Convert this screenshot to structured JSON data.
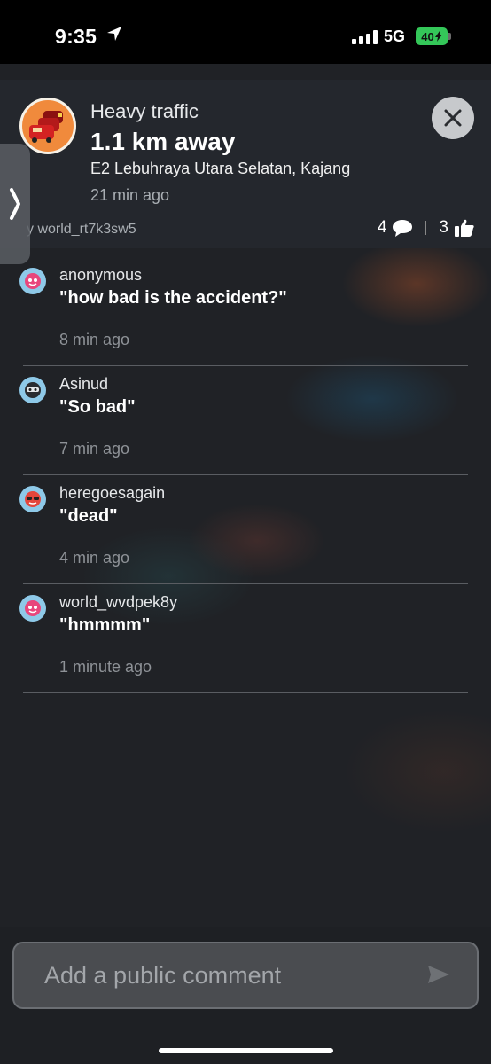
{
  "status_bar": {
    "time": "9:35",
    "network": "5G",
    "battery": "40"
  },
  "alert": {
    "type": "Heavy traffic",
    "distance": "1.1 km away",
    "road": "E2 Lebuhraya Utara Selatan, Kajang",
    "time_ago": "21 min ago",
    "reporter": "y world_rt7k3sw5",
    "comment_count": "4",
    "thumbs_up_count": "3",
    "icon": "traffic-jam-icon",
    "accent_color": "#f08a3c"
  },
  "comments": [
    {
      "user": "anonymous",
      "text": "\"how bad is the accident?\"",
      "time": "8 min ago",
      "avatar": "pink-wazer-icon"
    },
    {
      "user": "Asinud",
      "text": "\"So bad\"",
      "time": "7 min ago",
      "avatar": "ninja-wazer-icon"
    },
    {
      "user": "heregoesagain",
      "text": "\"dead\"",
      "time": "4 min ago",
      "avatar": "sunglasses-wazer-icon"
    },
    {
      "user": "world_wvdpek8y",
      "text": "\"hmmmm\"",
      "time": "1 minute ago",
      "avatar": "pink-wazer-icon"
    }
  ],
  "comment_input": {
    "placeholder": "Add a public comment"
  }
}
